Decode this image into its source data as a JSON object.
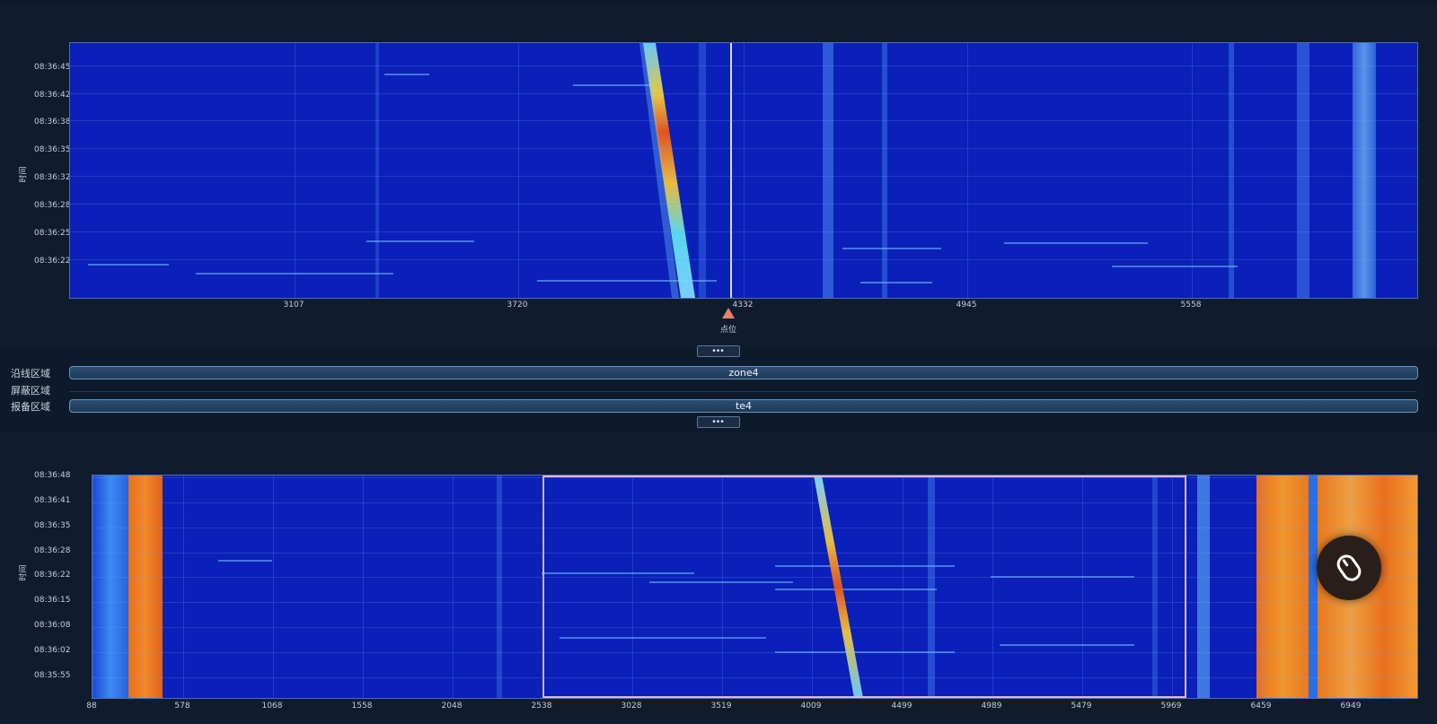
{
  "top_chart": {
    "ylabel": "时间",
    "yticks": [
      "08:36:45",
      "08:36:42",
      "08:36:38",
      "08:36:35",
      "08:36:32",
      "08:36:28",
      "08:36:25",
      "08:36:22"
    ],
    "xticks": [
      "3107",
      "3720",
      "4332",
      "4945",
      "5558"
    ],
    "cursor_position": 4332,
    "cursor_label": "点位"
  },
  "collapse_button_label": "•••",
  "zones": {
    "along_label": "沿线区域",
    "along_value": "zone4",
    "shield_label": "屏蔽区域",
    "report_label": "报备区域",
    "report_value": "te4"
  },
  "bottom_chart": {
    "ylabel": "时间",
    "yticks": [
      "08:36:48",
      "08:36:41",
      "08:36:35",
      "08:36:28",
      "08:36:22",
      "08:36:15",
      "08:36:08",
      "08:36:02",
      "08:35:55"
    ],
    "xticks": [
      "88",
      "578",
      "1068",
      "1558",
      "2048",
      "2538",
      "3028",
      "3519",
      "4009",
      "4499",
      "4989",
      "5479",
      "5969",
      "6459",
      "6949"
    ],
    "selection_range": [
      2538,
      6050
    ]
  },
  "icons": {
    "fab": "mouse-icon"
  },
  "colors": {
    "background": "#0d1a2b",
    "heatmap_base": "#0a20b8",
    "heatmap_hot": "#e8701e",
    "marker": "#e8806a",
    "selection_border": "#e6b8c8"
  }
}
